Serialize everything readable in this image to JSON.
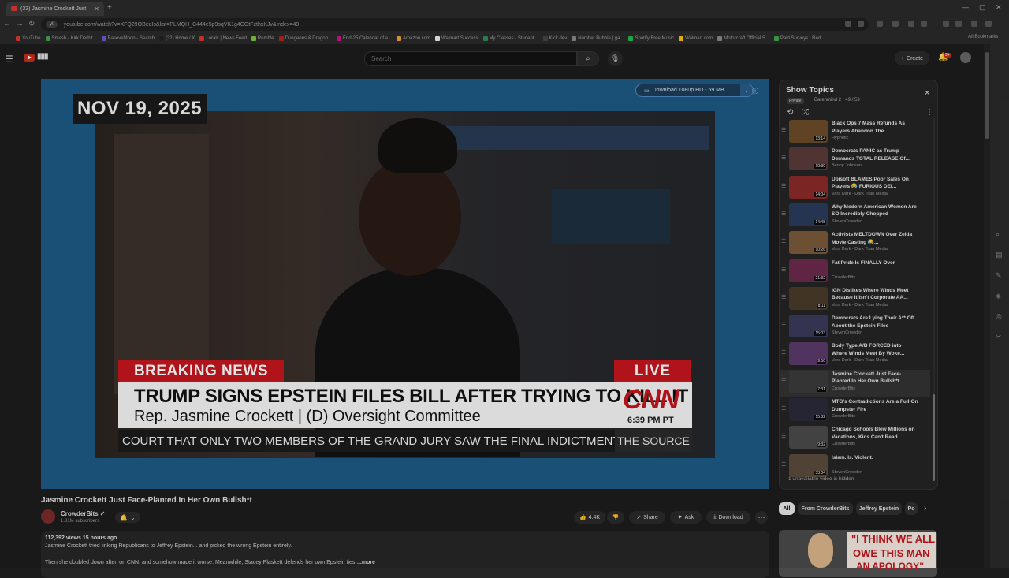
{
  "browser": {
    "tab_title": "(33) Jasmine Crockett Just",
    "address": "youtube.com/watch?v=XFQ29OBeaIs&list=PLMQH_C444e5p9sqVK1g4COtFzthxKJv&index=49",
    "address_pill": "yt",
    "bookmarks": [
      {
        "label": "YouTube",
        "color": "#d9372f"
      },
      {
        "label": "Smash - Kirk Derbit...",
        "color": "#3fa34d"
      },
      {
        "label": "BaseveMoon - Search",
        "color": "#6a5acd"
      },
      {
        "label": "(32) Home / X",
        "color": "#222222"
      },
      {
        "label": "Loralx | News Feed",
        "color": "#d9372f"
      },
      {
        "label": "Rumble",
        "color": "#7cc242"
      },
      {
        "label": "Dungeons & Dragon...",
        "color": "#b22222"
      },
      {
        "label": "End-25 Calendar of a...",
        "color": "#c71585"
      },
      {
        "label": "Amazon.com",
        "color": "#f0a030"
      },
      {
        "label": "Walmart Success",
        "color": "#eeeeee"
      },
      {
        "label": "My Classes - Student...",
        "color": "#2e8b57"
      },
      {
        "label": "Kick.dev",
        "color": "#444444"
      },
      {
        "label": "Number Bubble | ga...",
        "color": "#888888"
      },
      {
        "label": "Spotify Free Music",
        "color": "#1db954"
      },
      {
        "label": "Walmart.com",
        "color": "#f4c20d"
      },
      {
        "label": "Motorcraft Official S...",
        "color": "#888888"
      },
      {
        "label": "Paid Surveys | Redi...",
        "color": "#3fa34d"
      }
    ],
    "all_bookmarks": "All Bookmarks"
  },
  "header": {
    "search_placeholder": "Search",
    "create_label": "Create",
    "notif_count": "9+"
  },
  "player": {
    "date_overlay": "NOV 19, 2025",
    "breaking": "BREAKING NEWS",
    "live": "LIVE",
    "headline": "TRUMP SIGNS EPSTEIN FILES BILL AFTER TRYING TO KILL IT",
    "subline": "Rep. Jasmine Crockett   |   (D) Oversight Committee",
    "network": "CNN",
    "time": "6:39 PM PT",
    "ticker": "COURT THAT ONLY TWO MEMBERS OF THE GRAND JURY SAW THE FINAL INDICTMENT",
    "ticker_source": "THE SOURCE",
    "download_label": "Download 1080p HD - 69 MB"
  },
  "video": {
    "title": "Jasmine Crockett Just Face-Planted In Her Own Bullsh*t",
    "channel": "CrowderBits",
    "subscribers": "1.31M subscribers",
    "likes": "4.4K",
    "share": "Share",
    "ask": "Ask",
    "download": "Download",
    "meta": "112,392 views  15 hours ago",
    "desc_line1": "Jasmine Crockett tried linking Republicans to Jeffrey Epstein... and picked the wrong Epstein entirely.",
    "desc_line2": "Then she doubled down after, on CNN, and somehow made it worse. Meanwhile, Stacey Plaskett defends her own Epstein ties.",
    "more": "...more"
  },
  "playlist": {
    "title": "Show Topics",
    "privacy": "Private",
    "meta": "Barenmind 2 · 49 / 53",
    "hidden_note": "1 unavailable video is hidden",
    "items": [
      {
        "title": "Black Ops 7 Mass Refunds As Players Abandon The...",
        "channel": "Hypnotic",
        "duration": "13:14",
        "thumb": "#6b4a2a"
      },
      {
        "title": "Democrats PANIC as Trump Demands TOTAL RELEASE Of...",
        "channel": "Benny Johnson",
        "duration": "10:39",
        "thumb": "#5a3a3a"
      },
      {
        "title": "Ubisoft BLAMES Poor Sales On Players 😂 FURIOUS DEI...",
        "channel": "Vara Dark - Dark Titan Media",
        "duration": "14:04",
        "thumb": "#8a2a2a"
      },
      {
        "title": "Why Modern American Women Are SO Incredibly Chopped",
        "channel": "StevenCrowder",
        "duration": "14:48",
        "thumb": "#2a3a5a"
      },
      {
        "title": "Activists MELTDOWN Over Zelda Movie Casting 😂...",
        "channel": "Vara Dark - Dark Titan Media",
        "duration": "10:26",
        "thumb": "#7a5a3a"
      },
      {
        "title": "Fat Pride Is FINALLY Over",
        "channel": "CrowderBits",
        "duration": "21:32",
        "thumb": "#6a2a4a"
      },
      {
        "title": "IGN Dislikes Where Winds Meet Because It Isn't Corporate AA...",
        "channel": "Vara Dark - Dark Titan Media",
        "duration": "8:11",
        "thumb": "#4a3a2a"
      },
      {
        "title": "Democrats Are Lying Their A** Off About the Epstein Files",
        "channel": "StevenCrowder",
        "duration": "15:03",
        "thumb": "#3a3a5a"
      },
      {
        "title": "Body Type A/B FORCED into Where Winds Meet By Woke...",
        "channel": "Vara Dark - Dark Titan Media",
        "duration": "9:50",
        "thumb": "#5a3a6a"
      },
      {
        "title": "Jasmine Crockett Just Face-Planted In Her Own Bullsh*t",
        "channel": "CrowderBits",
        "duration": "7:31",
        "thumb": "#3a3a3a"
      },
      {
        "title": "MTG's Contradictions Are a Full-On Dumpster Fire",
        "channel": "CrowderBits",
        "duration": "15:32",
        "thumb": "#2a2a3a"
      },
      {
        "title": "Chicago Schools Blew Millions on Vacations, Kids Can't Read",
        "channel": "CrowderBits",
        "duration": "9:32",
        "thumb": "#4a4a4a"
      },
      {
        "title": "Islam. Is. Violent.",
        "channel": "StevenCrowder",
        "duration": "33:04",
        "thumb": "#5a4a3a"
      }
    ]
  },
  "chips": [
    "All",
    "From CrowderBits",
    "Jeffrey Epstein",
    "Po"
  ],
  "related": {
    "line1": "\"I THINK WE ALL",
    "line2": "OWE THIS MAN",
    "line3": "AN APOLOGY\""
  }
}
